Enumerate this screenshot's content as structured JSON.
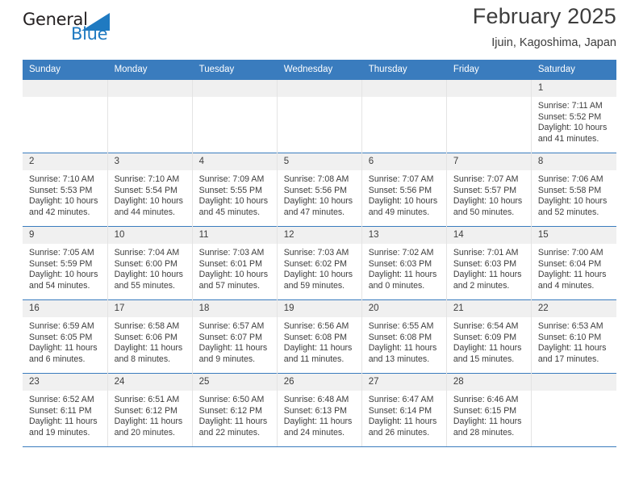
{
  "brand": {
    "name_part1": "General",
    "name_part2": "Blue",
    "accent_color": "#1f7ac1",
    "triangle_icon": "triangle-icon"
  },
  "header": {
    "title": "February 2025",
    "subtitle": "Ijuin, Kagoshima, Japan",
    "header_bg": "#3a7cbe"
  },
  "weekdays": [
    "Sunday",
    "Monday",
    "Tuesday",
    "Wednesday",
    "Thursday",
    "Friday",
    "Saturday"
  ],
  "weeks": [
    [
      {
        "day": "",
        "sunrise": "",
        "sunset": "",
        "daylight": "",
        "empty": true
      },
      {
        "day": "",
        "sunrise": "",
        "sunset": "",
        "daylight": "",
        "empty": true
      },
      {
        "day": "",
        "sunrise": "",
        "sunset": "",
        "daylight": "",
        "empty": true
      },
      {
        "day": "",
        "sunrise": "",
        "sunset": "",
        "daylight": "",
        "empty": true
      },
      {
        "day": "",
        "sunrise": "",
        "sunset": "",
        "daylight": "",
        "empty": true
      },
      {
        "day": "",
        "sunrise": "",
        "sunset": "",
        "daylight": "",
        "empty": true
      },
      {
        "day": "1",
        "sunrise": "Sunrise: 7:11 AM",
        "sunset": "Sunset: 5:52 PM",
        "daylight": "Daylight: 10 hours and 41 minutes.",
        "empty": false
      }
    ],
    [
      {
        "day": "2",
        "sunrise": "Sunrise: 7:10 AM",
        "sunset": "Sunset: 5:53 PM",
        "daylight": "Daylight: 10 hours and 42 minutes.",
        "empty": false
      },
      {
        "day": "3",
        "sunrise": "Sunrise: 7:10 AM",
        "sunset": "Sunset: 5:54 PM",
        "daylight": "Daylight: 10 hours and 44 minutes.",
        "empty": false
      },
      {
        "day": "4",
        "sunrise": "Sunrise: 7:09 AM",
        "sunset": "Sunset: 5:55 PM",
        "daylight": "Daylight: 10 hours and 45 minutes.",
        "empty": false
      },
      {
        "day": "5",
        "sunrise": "Sunrise: 7:08 AM",
        "sunset": "Sunset: 5:56 PM",
        "daylight": "Daylight: 10 hours and 47 minutes.",
        "empty": false
      },
      {
        "day": "6",
        "sunrise": "Sunrise: 7:07 AM",
        "sunset": "Sunset: 5:56 PM",
        "daylight": "Daylight: 10 hours and 49 minutes.",
        "empty": false
      },
      {
        "day": "7",
        "sunrise": "Sunrise: 7:07 AM",
        "sunset": "Sunset: 5:57 PM",
        "daylight": "Daylight: 10 hours and 50 minutes.",
        "empty": false
      },
      {
        "day": "8",
        "sunrise": "Sunrise: 7:06 AM",
        "sunset": "Sunset: 5:58 PM",
        "daylight": "Daylight: 10 hours and 52 minutes.",
        "empty": false
      }
    ],
    [
      {
        "day": "9",
        "sunrise": "Sunrise: 7:05 AM",
        "sunset": "Sunset: 5:59 PM",
        "daylight": "Daylight: 10 hours and 54 minutes.",
        "empty": false
      },
      {
        "day": "10",
        "sunrise": "Sunrise: 7:04 AM",
        "sunset": "Sunset: 6:00 PM",
        "daylight": "Daylight: 10 hours and 55 minutes.",
        "empty": false
      },
      {
        "day": "11",
        "sunrise": "Sunrise: 7:03 AM",
        "sunset": "Sunset: 6:01 PM",
        "daylight": "Daylight: 10 hours and 57 minutes.",
        "empty": false
      },
      {
        "day": "12",
        "sunrise": "Sunrise: 7:03 AM",
        "sunset": "Sunset: 6:02 PM",
        "daylight": "Daylight: 10 hours and 59 minutes.",
        "empty": false
      },
      {
        "day": "13",
        "sunrise": "Sunrise: 7:02 AM",
        "sunset": "Sunset: 6:03 PM",
        "daylight": "Daylight: 11 hours and 0 minutes.",
        "empty": false
      },
      {
        "day": "14",
        "sunrise": "Sunrise: 7:01 AM",
        "sunset": "Sunset: 6:03 PM",
        "daylight": "Daylight: 11 hours and 2 minutes.",
        "empty": false
      },
      {
        "day": "15",
        "sunrise": "Sunrise: 7:00 AM",
        "sunset": "Sunset: 6:04 PM",
        "daylight": "Daylight: 11 hours and 4 minutes.",
        "empty": false
      }
    ],
    [
      {
        "day": "16",
        "sunrise": "Sunrise: 6:59 AM",
        "sunset": "Sunset: 6:05 PM",
        "daylight": "Daylight: 11 hours and 6 minutes.",
        "empty": false
      },
      {
        "day": "17",
        "sunrise": "Sunrise: 6:58 AM",
        "sunset": "Sunset: 6:06 PM",
        "daylight": "Daylight: 11 hours and 8 minutes.",
        "empty": false
      },
      {
        "day": "18",
        "sunrise": "Sunrise: 6:57 AM",
        "sunset": "Sunset: 6:07 PM",
        "daylight": "Daylight: 11 hours and 9 minutes.",
        "empty": false
      },
      {
        "day": "19",
        "sunrise": "Sunrise: 6:56 AM",
        "sunset": "Sunset: 6:08 PM",
        "daylight": "Daylight: 11 hours and 11 minutes.",
        "empty": false
      },
      {
        "day": "20",
        "sunrise": "Sunrise: 6:55 AM",
        "sunset": "Sunset: 6:08 PM",
        "daylight": "Daylight: 11 hours and 13 minutes.",
        "empty": false
      },
      {
        "day": "21",
        "sunrise": "Sunrise: 6:54 AM",
        "sunset": "Sunset: 6:09 PM",
        "daylight": "Daylight: 11 hours and 15 minutes.",
        "empty": false
      },
      {
        "day": "22",
        "sunrise": "Sunrise: 6:53 AM",
        "sunset": "Sunset: 6:10 PM",
        "daylight": "Daylight: 11 hours and 17 minutes.",
        "empty": false
      }
    ],
    [
      {
        "day": "23",
        "sunrise": "Sunrise: 6:52 AM",
        "sunset": "Sunset: 6:11 PM",
        "daylight": "Daylight: 11 hours and 19 minutes.",
        "empty": false
      },
      {
        "day": "24",
        "sunrise": "Sunrise: 6:51 AM",
        "sunset": "Sunset: 6:12 PM",
        "daylight": "Daylight: 11 hours and 20 minutes.",
        "empty": false
      },
      {
        "day": "25",
        "sunrise": "Sunrise: 6:50 AM",
        "sunset": "Sunset: 6:12 PM",
        "daylight": "Daylight: 11 hours and 22 minutes.",
        "empty": false
      },
      {
        "day": "26",
        "sunrise": "Sunrise: 6:48 AM",
        "sunset": "Sunset: 6:13 PM",
        "daylight": "Daylight: 11 hours and 24 minutes.",
        "empty": false
      },
      {
        "day": "27",
        "sunrise": "Sunrise: 6:47 AM",
        "sunset": "Sunset: 6:14 PM",
        "daylight": "Daylight: 11 hours and 26 minutes.",
        "empty": false
      },
      {
        "day": "28",
        "sunrise": "Sunrise: 6:46 AM",
        "sunset": "Sunset: 6:15 PM",
        "daylight": "Daylight: 11 hours and 28 minutes.",
        "empty": false
      },
      {
        "day": "",
        "sunrise": "",
        "sunset": "",
        "daylight": "",
        "empty": true
      }
    ]
  ]
}
